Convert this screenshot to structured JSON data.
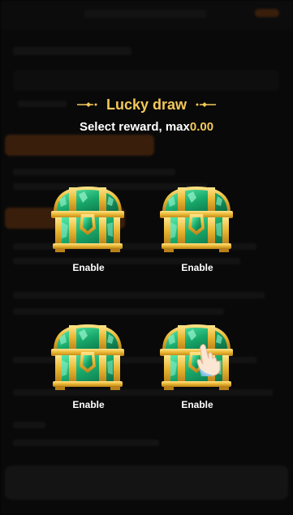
{
  "modal": {
    "title": "Lucky draw",
    "subtitle_prefix": "Select reward, max",
    "max_amount": "0.00",
    "chests": [
      {
        "label": "Enable"
      },
      {
        "label": "Enable"
      },
      {
        "label": "Enable"
      },
      {
        "label": "Enable"
      }
    ]
  },
  "icons": {
    "title_decoration": "sparkle-arrow-icon",
    "chest": "treasure-chest-icon",
    "pointer": "pointing-hand-icon"
  },
  "colors": {
    "accent_gold": "#f3c85a",
    "chest_green": "#18a86a",
    "chest_gold": "#e8b52f",
    "overlay": "rgba(0,0,0,0.66)"
  }
}
